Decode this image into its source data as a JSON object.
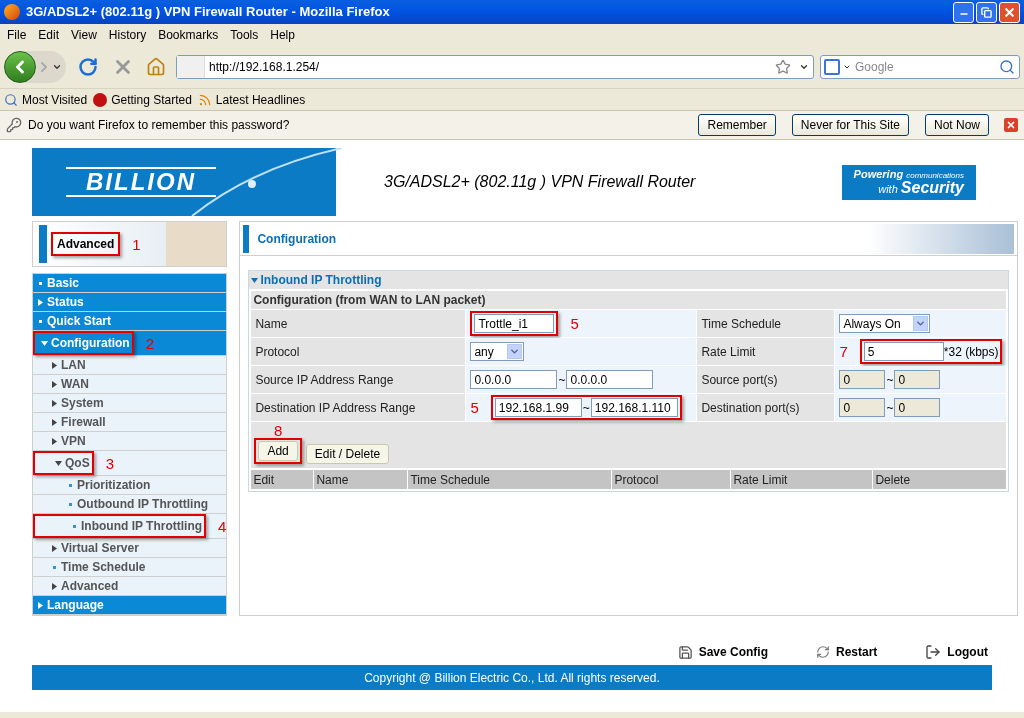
{
  "window": {
    "title": "3G/ADSL2+ (802.11g ) VPN Firewall Router - Mozilla Firefox"
  },
  "menu": [
    "File",
    "Edit",
    "View",
    "History",
    "Bookmarks",
    "Tools",
    "Help"
  ],
  "address": {
    "value": "http://192.168.1.254/"
  },
  "search": {
    "placeholder": "Google"
  },
  "bookmarks": [
    "Most Visited",
    "Getting Started",
    "Latest Headlines"
  ],
  "notification": {
    "message": "Do you want Firefox to remember this password?",
    "buttons": [
      "Remember",
      "Never for This Site",
      "Not Now"
    ]
  },
  "banner": {
    "logo": "BILLION",
    "title": "3G/ADSL2+ (802.11g ) VPN Firewall Router",
    "tagline_top": "Powering",
    "tagline_small": "communications",
    "tagline_with": "with",
    "tagline_main": "Security"
  },
  "mode": {
    "label": "Advanced",
    "callout": {
      "text": "1",
      "kind": "trailing"
    }
  },
  "sidebar": [
    {
      "label": "Basic",
      "kind": "leaf"
    },
    {
      "label": "Status",
      "kind": "folder",
      "expanded": false
    },
    {
      "label": "Quick Start",
      "kind": "leaf"
    },
    {
      "label": "Configuration",
      "kind": "folder",
      "expanded": true,
      "callout": {
        "text": "2",
        "kind": "trailing"
      },
      "children": [
        {
          "label": "LAN",
          "kind": "folder",
          "expanded": false
        },
        {
          "label": "WAN",
          "kind": "folder",
          "expanded": false
        },
        {
          "label": "System",
          "kind": "folder",
          "expanded": false
        },
        {
          "label": "Firewall",
          "kind": "folder",
          "expanded": false
        },
        {
          "label": "VPN",
          "kind": "folder",
          "expanded": false
        },
        {
          "label": "QoS",
          "kind": "folder",
          "expanded": true,
          "callout": {
            "text": "3",
            "kind": "trailing"
          },
          "children": [
            {
              "label": "Prioritization",
              "kind": "leaf"
            },
            {
              "label": "Outbound IP Throttling",
              "kind": "leaf"
            },
            {
              "label": "Inbound IP Throttling",
              "kind": "leaf",
              "callout": {
                "text": "4",
                "kind": "trailing"
              }
            }
          ]
        },
        {
          "label": "Virtual Server",
          "kind": "folder",
          "expanded": false
        },
        {
          "label": "Time Schedule",
          "kind": "leaf"
        },
        {
          "label": "Advanced",
          "kind": "folder",
          "expanded": false
        }
      ]
    },
    {
      "label": "Language",
      "kind": "folder",
      "expanded": false
    }
  ],
  "page_title": "Configuration",
  "panel": {
    "title": "Inbound IP Throttling",
    "expanded": true,
    "caption": "Configuration (from WAN to LAN packet)",
    "rows": [
      {
        "left": {
          "label": "Name",
          "kind": "text",
          "value": "Trottle_i1",
          "callout": {
            "text": "5",
            "kind": "trailing"
          }
        },
        "right": {
          "label": "Time Schedule",
          "kind": "select",
          "value": "Always On"
        }
      },
      {
        "left": {
          "label": "Protocol",
          "kind": "select",
          "value": "any"
        },
        "right": {
          "label": "Rate Limit",
          "kind": "text",
          "value": "5",
          "suffix": "*32 (kbps)",
          "callout": {
            "text": "7",
            "kind": "leading"
          }
        }
      },
      {
        "left": {
          "label": "Source IP Address Range",
          "kind": "range",
          "values": [
            "0.0.0.0",
            "0.0.0.0"
          ],
          "separator": "~"
        },
        "right": {
          "label": "Source port(s)",
          "kind": "range",
          "values": [
            "0",
            "0"
          ],
          "separator": "~",
          "disabled": true
        }
      },
      {
        "left": {
          "label": "Destination IP Address Range",
          "kind": "range",
          "values": [
            "192.168.1.99",
            "192.168.1.110"
          ],
          "separator": "~",
          "callout": {
            "text": "5",
            "kind": "leading"
          }
        },
        "right": {
          "label": "Destination port(s)",
          "kind": "range",
          "values": [
            "0",
            "0"
          ],
          "separator": "~",
          "disabled": true
        }
      }
    ],
    "buttons": [
      {
        "label": "Add",
        "callout": {
          "text": "8",
          "kind": "above"
        }
      },
      {
        "label": "Edit / Delete"
      }
    ],
    "columns": [
      "Edit",
      "Name",
      "Time Schedule",
      "Protocol",
      "Rate Limit",
      "Delete"
    ]
  },
  "footer_links": [
    {
      "label": "Save Config",
      "kind": "save"
    },
    {
      "label": "Restart",
      "kind": "restart"
    },
    {
      "label": "Logout",
      "kind": "logout"
    }
  ],
  "copyright": "Copyright @ Billion Electric Co., Ltd. All rights reserved."
}
